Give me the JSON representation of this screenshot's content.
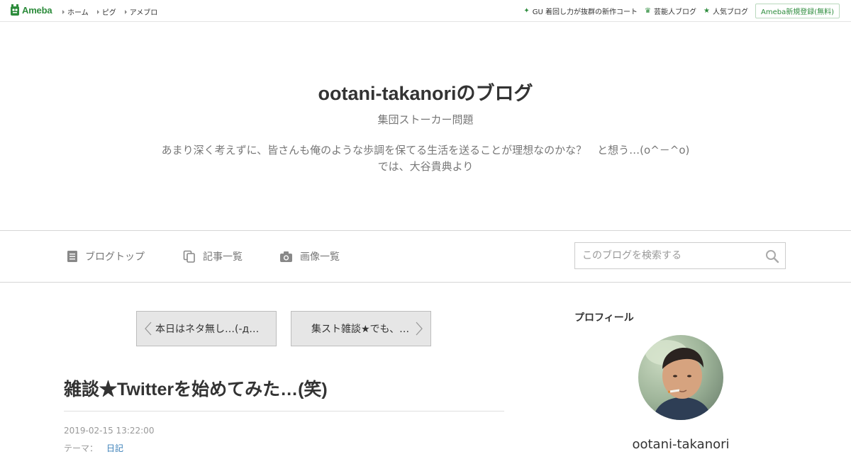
{
  "topbar": {
    "logo_text": "Ameba",
    "nav": [
      "ホーム",
      "ピグ",
      "アメブロ"
    ],
    "links": [
      {
        "icon": "sparkle-icon",
        "label": "GU 着回し力が抜群の新作コート"
      },
      {
        "icon": "crown-icon",
        "label": "芸能人ブログ"
      },
      {
        "icon": "star-icon",
        "label": "人気ブログ"
      }
    ],
    "register_label": "Ameba新規登録(無料)"
  },
  "header": {
    "title": "ootani-takanoriのブログ",
    "subtitle": "集団ストーカー問題",
    "description_line1": "あまり深く考えずに、皆さんも俺のような歩調を保てる生活を送ることが理想なのかな？　と想う…(o^－^o)",
    "description_line2": "では、大谷貴典より"
  },
  "nav": {
    "blog_top": "ブログトップ",
    "article_list": "記事一覧",
    "image_list": "画像一覧"
  },
  "search": {
    "placeholder": "このブログを検索する"
  },
  "pager": {
    "prev": "本日はネタ無し…(-д…",
    "next": "集スト雑談★でも、…"
  },
  "article": {
    "title": "雑談★Twitterを始めてみた…(笑)",
    "date": "2019-02-15 13:22:00",
    "theme_label": "テーマ：",
    "theme_link": "日記"
  },
  "sidebar": {
    "heading": "プロフィール",
    "profile_name": "ootani-takanori"
  },
  "colors": {
    "brand_green": "#2d8c3c",
    "link_blue": "#3a7fb8"
  }
}
